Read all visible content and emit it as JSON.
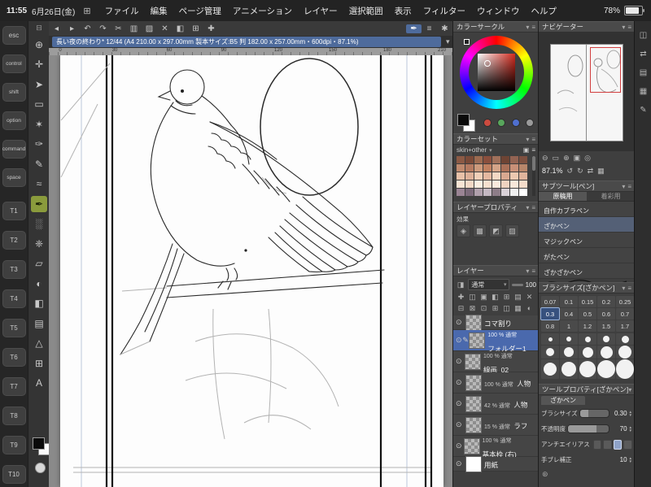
{
  "status_bar": {
    "time": "11:55",
    "date": "6月26日(金)",
    "battery_percent": "78%"
  },
  "menu_bar": {
    "items": [
      "ファイル",
      "編集",
      "ページ管理",
      "アニメーション",
      "レイヤー",
      "選択範囲",
      "表示",
      "フィルター",
      "ウィンドウ",
      "ヘルプ"
    ]
  },
  "edge_keys": {
    "keys": [
      "esc",
      "control",
      "shift",
      "option",
      "command",
      "space",
      "T1",
      "T2",
      "T3",
      "T4",
      "T5",
      "T6",
      "T7",
      "T8",
      "T9",
      "T10"
    ]
  },
  "toolbox": {
    "tools": [
      {
        "name": "zoom-tool",
        "glyph": "⊕"
      },
      {
        "name": "move-tool",
        "glyph": "✛"
      },
      {
        "name": "operation-tool",
        "glyph": "➤"
      },
      {
        "name": "selection-tool",
        "glyph": "▭"
      },
      {
        "name": "auto-select-tool",
        "glyph": "✶"
      },
      {
        "name": "eyedropper-tool",
        "glyph": "✑"
      },
      {
        "name": "pencil-tool",
        "glyph": "✎"
      },
      {
        "name": "brush-tool",
        "glyph": "≈"
      },
      {
        "name": "pen-tool",
        "glyph": "✒"
      },
      {
        "name": "airbrush-tool",
        "glyph": "░"
      },
      {
        "name": "decoration-tool",
        "glyph": "❈"
      },
      {
        "name": "eraser-tool",
        "glyph": "▱"
      },
      {
        "name": "blend-tool",
        "glyph": "◐"
      },
      {
        "name": "fill-tool",
        "glyph": "◧"
      },
      {
        "name": "gradient-tool",
        "glyph": "▤"
      },
      {
        "name": "figure-tool",
        "glyph": "△"
      },
      {
        "name": "frame-border-tool",
        "glyph": "⊞"
      },
      {
        "name": "text-tool",
        "glyph": "A"
      }
    ]
  },
  "toolbar": {
    "icons": [
      {
        "name": "prev-page-icon",
        "glyph": "◂"
      },
      {
        "name": "next-page-icon",
        "glyph": "▸"
      },
      {
        "name": "undo-icon",
        "glyph": "↶"
      },
      {
        "name": "redo-icon",
        "glyph": "↷"
      },
      {
        "name": "cut-icon",
        "glyph": "✂"
      },
      {
        "name": "copy-icon",
        "glyph": "▥"
      },
      {
        "name": "paste-icon",
        "glyph": "▨"
      },
      {
        "name": "delete-icon",
        "glyph": "✕"
      },
      {
        "name": "fill-icon",
        "glyph": "◧"
      },
      {
        "name": "grid-icon",
        "glyph": "⊞"
      },
      {
        "name": "snap-icon",
        "glyph": "✚"
      },
      {
        "name": "pen-mode-icon",
        "glyph": "✒"
      },
      {
        "name": "touch-mode-icon",
        "glyph": "≡"
      },
      {
        "name": "settings-icon",
        "glyph": "✱"
      }
    ]
  },
  "document_tab": {
    "title": "長い夜の終わり* 12/44 (A4 210.00 x 297.00mm 製本サイズ:B5 判 182.00 x 257.00mm・600dpi・87.1%)",
    "chevron": "▾"
  },
  "ruler": {
    "labels": [
      "0",
      "30",
      "60",
      "90",
      "120",
      "150",
      "180",
      "210"
    ]
  },
  "color_circle": {
    "title": "カラーサークル"
  },
  "color_set": {
    "title": "カラーセット",
    "set_name": "skin+other",
    "swatches": [
      "#8c5a45",
      "#7a4a38",
      "#9c6a50",
      "#8a4f3d",
      "#a0705a",
      "#6e4434",
      "#936352",
      "#7d5040",
      "#c08a6e",
      "#b57a60",
      "#cc9a7c",
      "#c08060",
      "#d4a488",
      "#aa7058",
      "#c89078",
      "#b8866a",
      "#e8c0a8",
      "#ddb098",
      "#f0cfb8",
      "#e4b8a0",
      "#f4d8c4",
      "#d8a890",
      "#ecc8b0",
      "#e0b49c",
      "#f8e4d4",
      "#f2d8c6",
      "#fceee2",
      "#f6e0d0",
      "#faeadd",
      "#eed2c0",
      "#f8e8da",
      "#f4dcca",
      "#9a8494",
      "#7c6a7a",
      "#b0a0ac",
      "#c4b8c2",
      "#8d7d88",
      "#d8d0d6",
      "#efefef",
      "#ffffff"
    ]
  },
  "layer_property": {
    "title": "レイヤープロパティ",
    "effect_label": "効果"
  },
  "layer_panel": {
    "title": "レイヤー",
    "blend_mode": "通常",
    "opacity_value": "100",
    "layers": [
      {
        "info": "",
        "name": "コマ割り"
      },
      {
        "info": "100 % 通常",
        "name": "フォルダー1"
      },
      {
        "info": "100 % 通常",
        "name": "線画_02"
      },
      {
        "info": "100 % 通常",
        "name": "人物"
      },
      {
        "info": "42 % 通常",
        "name": "人物"
      },
      {
        "info": "15 % 通常",
        "name": "ラフ"
      },
      {
        "info": "100 % 通常",
        "name": "基本枠 (右)"
      },
      {
        "info": "",
        "name": "用紙"
      }
    ]
  },
  "navigator": {
    "title": "ナビゲーター",
    "zoom_value": "87.1%"
  },
  "subtool": {
    "title": "サブツール[ペン]",
    "tabs": [
      "原稿用",
      "着彩用"
    ],
    "items": [
      "自作カブラペン",
      "ざかペン",
      "マジックペン",
      "がたペン",
      "ざかざかペン"
    ]
  },
  "brush_size": {
    "title": "ブラシサイズ[ざかペン]",
    "rows": [
      [
        "0.07",
        "0.1",
        "0.15",
        "0.2",
        "0.25"
      ],
      [
        "0.3",
        "0.4",
        "0.5",
        "0.6",
        "0.7"
      ],
      [
        "0.8",
        "1",
        "1.2",
        "1.5",
        "1.7"
      ]
    ],
    "selected_value": "0.3"
  },
  "tool_property": {
    "title": "ツールプロパティ[ざかペン]",
    "subtool_name": "ざかペン",
    "rows": {
      "brush_size_label": "ブラシサイズ",
      "brush_size_value": "0.30",
      "opacity_label": "不透明度",
      "opacity_value": "70",
      "antialias_label": "アンチエイリアス",
      "stabilization_label": "手ブレ補正",
      "stabilization_value": "10"
    }
  },
  "colors": {
    "accent_blue": "#4e6b9c",
    "selected_green": "#8a9b3c",
    "selection_red": "#d23f3f",
    "canvas_gray": "#8a8a8a"
  }
}
